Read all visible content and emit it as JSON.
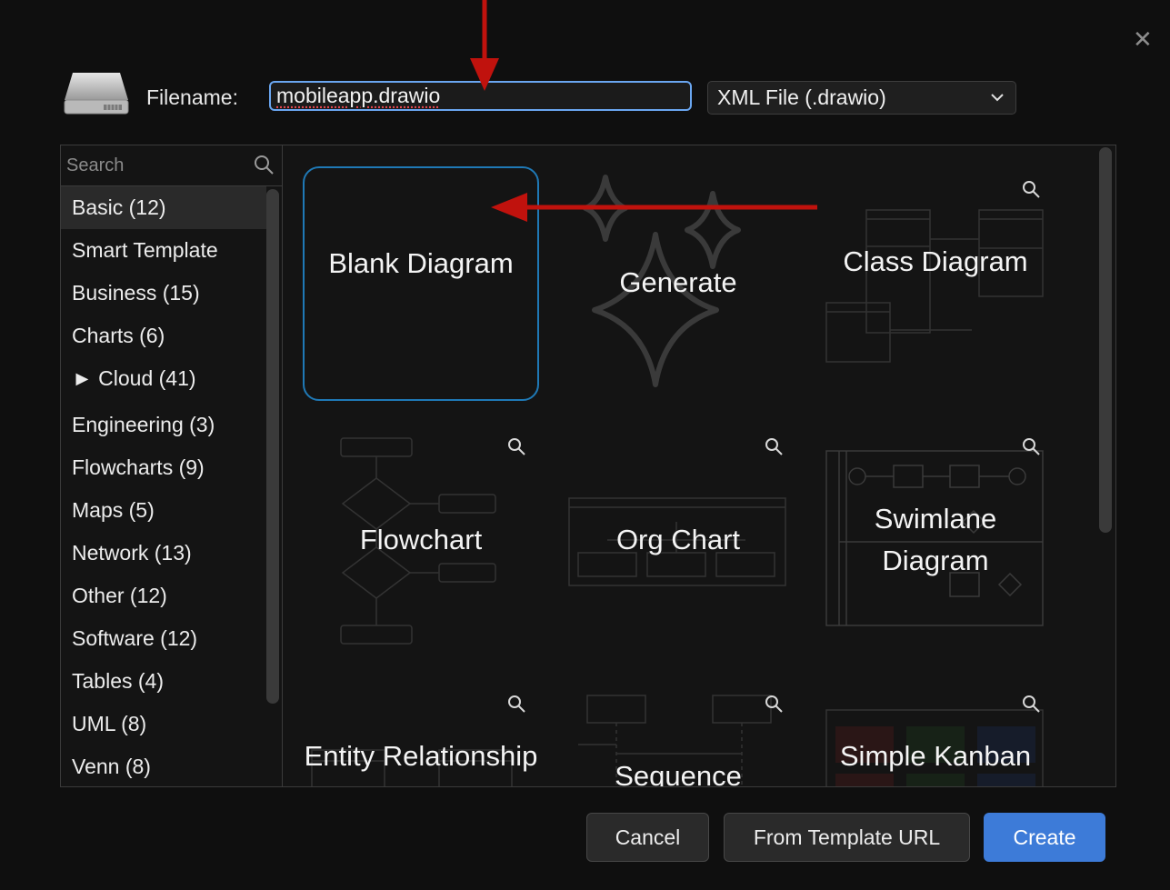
{
  "dialog": {
    "close_icon": "close-icon",
    "filename_label": "Filename:",
    "filename_value": "mobileapp.drawio",
    "format_selected": "XML File (.drawio)"
  },
  "sidebar": {
    "search_placeholder": "Search",
    "categories": [
      {
        "label": "Basic (12)"
      },
      {
        "label": "Smart Template"
      },
      {
        "label": "Business (15)"
      },
      {
        "label": "Charts (6)"
      },
      {
        "label": "► Cloud (41)"
      },
      {
        "label": "Engineering (3)"
      },
      {
        "label": "Flowcharts (9)"
      },
      {
        "label": "Maps (5)"
      },
      {
        "label": "Network (13)"
      },
      {
        "label": "Other (12)"
      },
      {
        "label": "Software (12)"
      },
      {
        "label": "Tables (4)"
      },
      {
        "label": "UML (8)"
      },
      {
        "label": "Venn (8)"
      }
    ]
  },
  "templates": [
    {
      "label": "Blank Diagram"
    },
    {
      "label": "Generate"
    },
    {
      "label": "Class Diagram"
    },
    {
      "label": "Flowchart"
    },
    {
      "label": "Org Chart"
    },
    {
      "label": "Swimlane Diagram"
    },
    {
      "label": "Entity Relationship"
    },
    {
      "label": "Sequence"
    },
    {
      "label": "Simple Kanban"
    }
  ],
  "buttons": {
    "cancel": "Cancel",
    "from_template_url": "From Template URL",
    "create": "Create"
  },
  "colors": {
    "accent": "#3d7bd8",
    "selected_border": "#1f79b6",
    "annotation_arrow": "#c0120d"
  }
}
